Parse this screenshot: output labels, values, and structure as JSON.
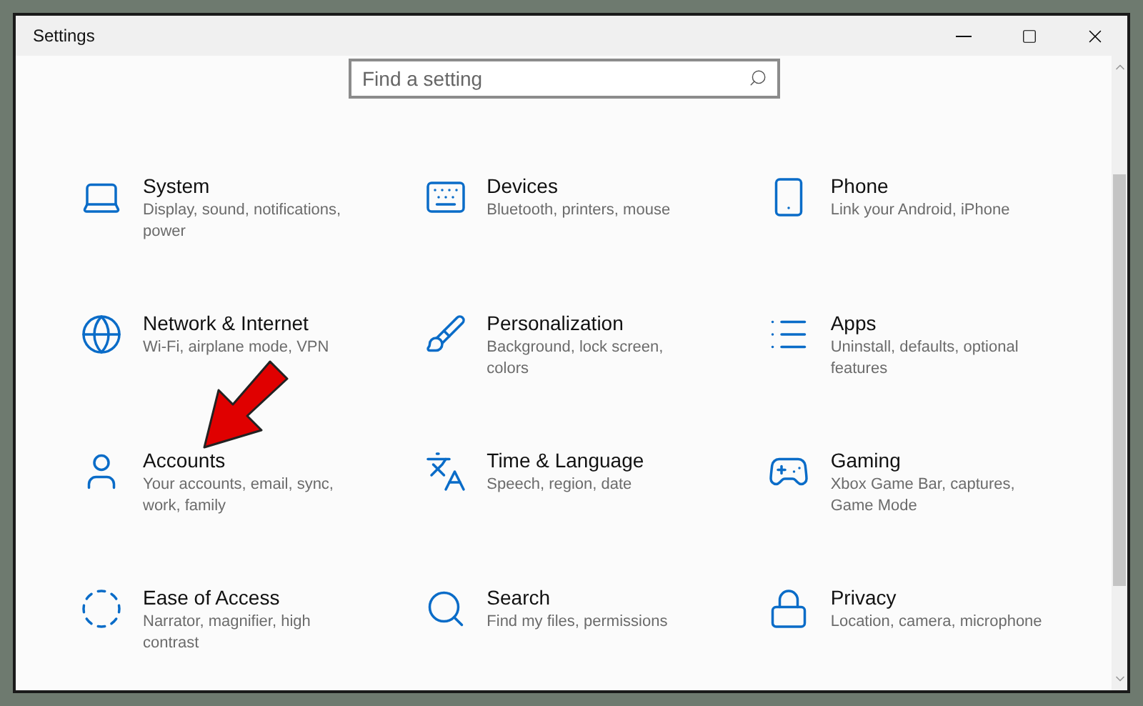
{
  "window": {
    "title": "Settings"
  },
  "search": {
    "placeholder": "Find a setting"
  },
  "categories": [
    {
      "title": "System",
      "description": "Display, sound, notifications, power"
    },
    {
      "title": "Devices",
      "description": "Bluetooth, printers, mouse"
    },
    {
      "title": "Phone",
      "description": "Link your Android, iPhone"
    },
    {
      "title": "Network & Internet",
      "description": "Wi-Fi, airplane mode, VPN"
    },
    {
      "title": "Personalization",
      "description": "Background, lock screen, colors"
    },
    {
      "title": "Apps",
      "description": "Uninstall, defaults, optional features"
    },
    {
      "title": "Accounts",
      "description": "Your accounts, email, sync, work, family"
    },
    {
      "title": "Time & Language",
      "description": "Speech, region, date"
    },
    {
      "title": "Gaming",
      "description": "Xbox Game Bar, captures, Game Mode"
    },
    {
      "title": "Ease of Access",
      "description": "Narrator, magnifier, high contrast"
    },
    {
      "title": "Search",
      "description": "Find my files, permissions"
    },
    {
      "title": "Privacy",
      "description": "Location, camera, microphone"
    }
  ]
}
